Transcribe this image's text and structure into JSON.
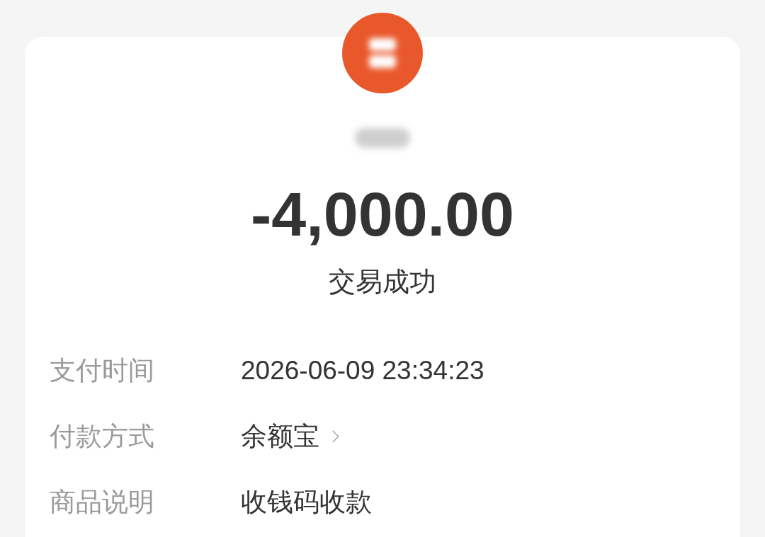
{
  "header": {
    "amount": "-4,000.00",
    "status": "交易成功"
  },
  "details": [
    {
      "kind": "text",
      "label": "支付时间",
      "value": "2026-06-09 23:34:23"
    },
    {
      "kind": "link",
      "label": "付款方式",
      "value": "余额宝"
    },
    {
      "kind": "text",
      "label": "商品说明",
      "value": "收钱码收款"
    }
  ]
}
